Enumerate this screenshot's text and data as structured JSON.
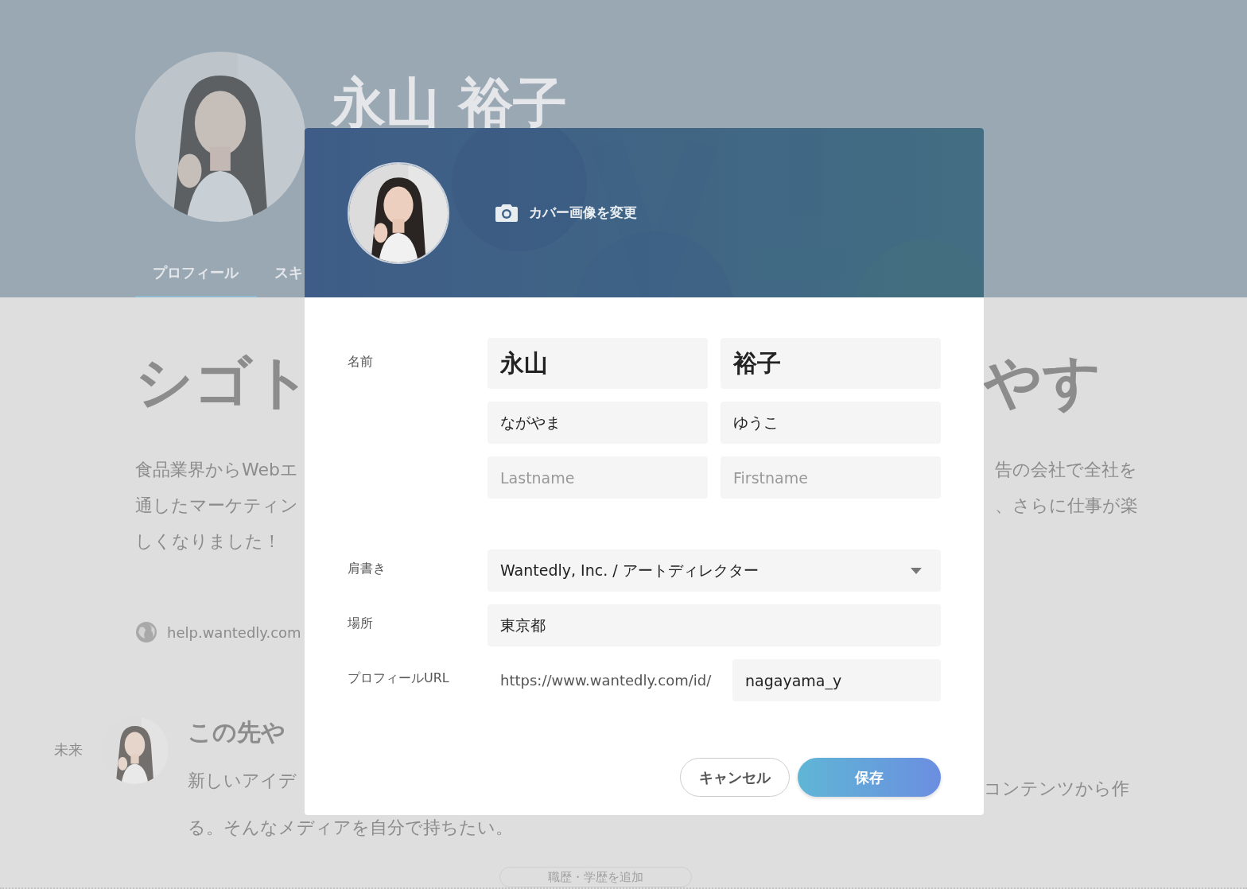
{
  "profile_header": {
    "name": "永山 裕子",
    "tabs": [
      {
        "label": "プロフィール",
        "selected": true
      },
      {
        "label": "スキ",
        "selected": false
      }
    ]
  },
  "background": {
    "headline_left": "シゴト",
    "headline_right": "やす",
    "intro_left": [
      "食品業界からWebエ",
      "通したマーケティン",
      "しくなりました！"
    ],
    "intro_right": [
      "告の会社で全社を",
      "、さらに仕事が楽"
    ],
    "link": "help.wantedly.com",
    "future": {
      "label": "未来",
      "heading": "この先や",
      "lines_left": [
        "新しいアイデ",
        "る。そんなメディアを自分で持ちたい。"
      ],
      "line_right": "コンテンツから作"
    },
    "add_button": "職歴・学歴を追加"
  },
  "modal": {
    "cover_button": "カバー画像を変更",
    "name": {
      "label": "名前",
      "rows": [
        [
          {
            "value": "永山"
          },
          {
            "value": "裕子"
          }
        ],
        [
          {
            "value": "ながやま"
          },
          {
            "value": "ゆうこ"
          }
        ],
        [
          {
            "placeholder": "Lastname"
          },
          {
            "placeholder": "Firstname"
          }
        ]
      ]
    },
    "title": {
      "label": "肩書き",
      "value": "Wantedly, Inc. / アートディレクター"
    },
    "location": {
      "label": "場所",
      "value": "東京都"
    },
    "url": {
      "label": "プロフィールURL",
      "prefix": "https://www.wantedly.com/id/",
      "value": "nagayama_y"
    },
    "buttons": [
      {
        "label": "キャンセル",
        "kind": "secondary"
      },
      {
        "label": "保存",
        "kind": "primary"
      }
    ]
  }
}
